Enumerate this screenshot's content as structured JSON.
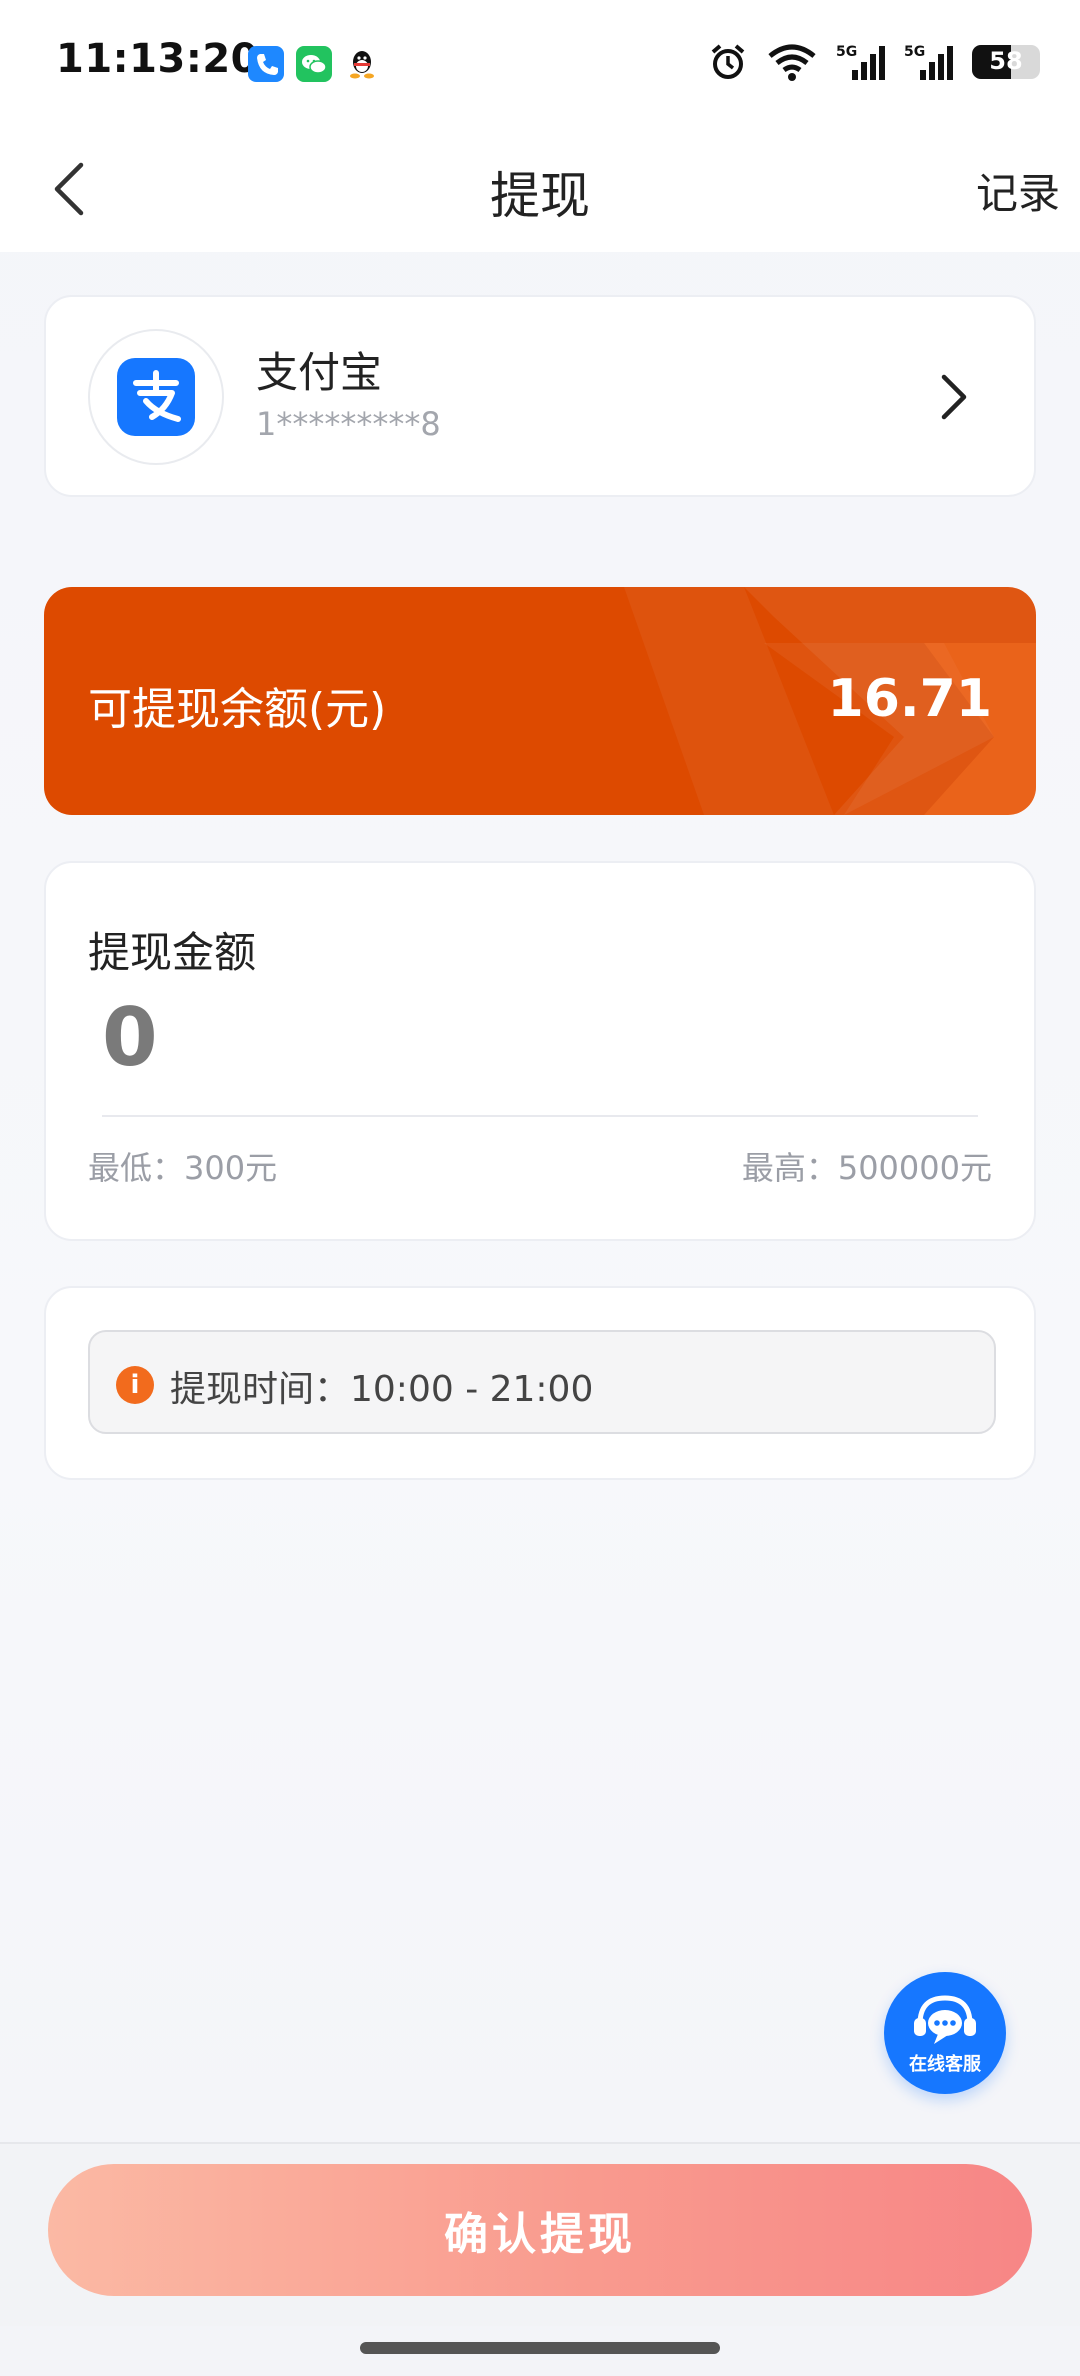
{
  "status_bar": {
    "time": "11:13:20",
    "battery_level": "58",
    "battery_fraction": 0.58,
    "notification_icons": [
      "phone-icon",
      "wechat-icon",
      "qq-icon"
    ],
    "system_icons": [
      "alarm-icon",
      "wifi-icon",
      "signal-5g-icon",
      "signal-5g-icon",
      "battery-icon"
    ]
  },
  "nav": {
    "title": "提现",
    "record_label": "记录",
    "back_icon": "back-arrow-icon"
  },
  "account": {
    "name": "支付宝",
    "masked": "1*********8",
    "logo_glyph": "支",
    "brand_color": "#1677ff"
  },
  "balance": {
    "label": "可提现余额(元)",
    "value": "16.71",
    "bg_color": "#dd4a00"
  },
  "amount": {
    "label": "提现金额",
    "input_value": "0",
    "min_text": "最低：300元",
    "max_text": "最高：500000元"
  },
  "withdraw_time": {
    "icon_glyph": "i",
    "text": "提现时间：10:00 - 21:00"
  },
  "customer_service": {
    "label": "在线客服"
  },
  "confirm": {
    "label": "确认提现"
  }
}
